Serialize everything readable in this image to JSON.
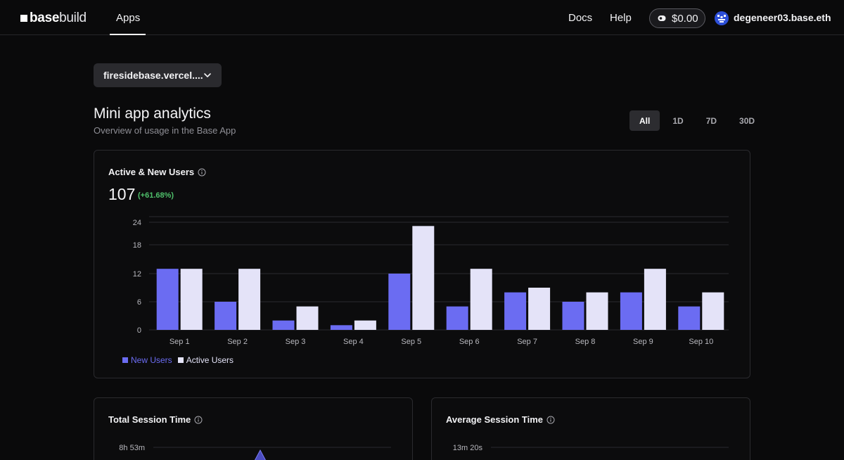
{
  "nav": {
    "logo_bold": "base",
    "logo_light": "build",
    "apps_label": "Apps",
    "docs_label": "Docs",
    "help_label": "Help",
    "balance": "$0.00",
    "username": "degeneer03.base.eth"
  },
  "site_selector": {
    "value": "firesidebase.vercel...."
  },
  "page": {
    "title": "Mini app analytics",
    "subtitle": "Overview of usage in the Base App"
  },
  "range_tabs": [
    {
      "label": "All",
      "active": true
    },
    {
      "label": "1D",
      "active": false
    },
    {
      "label": "7D",
      "active": false
    },
    {
      "label": "30D",
      "active": false
    }
  ],
  "active_users_card": {
    "title": "Active & New Users",
    "total": "107",
    "delta": "(+61.68%)"
  },
  "session_cards": [
    {
      "title": "Total Session Time",
      "first_tick": "8h 53m"
    },
    {
      "title": "Average Session Time",
      "first_tick": "13m 20s"
    }
  ],
  "colors": {
    "new_users": "#6b6cf2",
    "active_users": "#e4e3f8",
    "delta_positive": "#4fc06b"
  },
  "chart_data": {
    "type": "bar",
    "categories": [
      "Sep 1",
      "Sep 2",
      "Sep 3",
      "Sep 4",
      "Sep 5",
      "Sep 6",
      "Sep 7",
      "Sep 8",
      "Sep 9",
      "Sep 10"
    ],
    "series": [
      {
        "name": "New Users",
        "values": [
          13,
          6,
          2,
          1,
          12,
          5,
          8,
          6,
          8,
          5
        ]
      },
      {
        "name": "Active Users",
        "values": [
          13,
          13,
          5,
          2,
          23,
          13,
          9,
          8,
          13,
          8
        ]
      }
    ],
    "y_ticks": [
      "0",
      "6",
      "12",
      "18",
      "24"
    ],
    "ylim": [
      0,
      24
    ],
    "grid": true,
    "legend_position": "bottom-left"
  }
}
